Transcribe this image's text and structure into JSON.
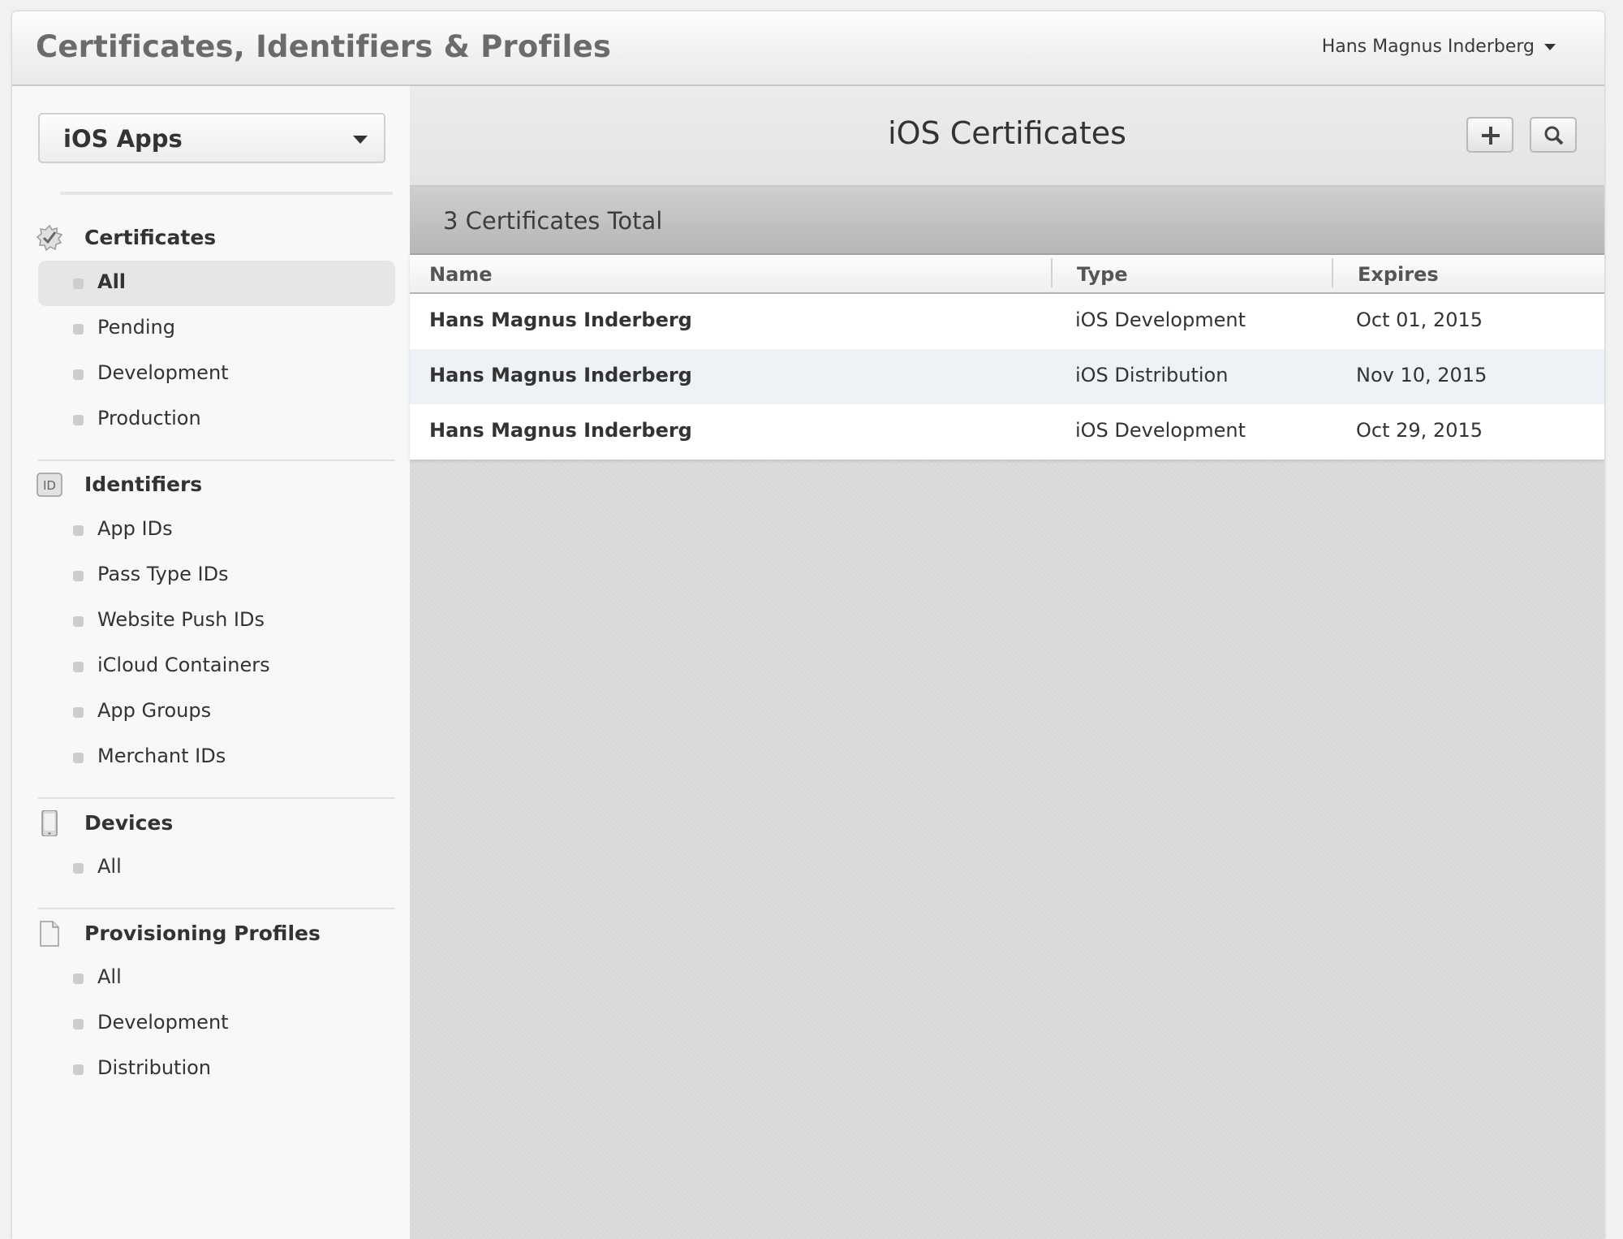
{
  "header": {
    "title": "Certificates, Identifiers & Profiles",
    "user_name": "Hans Magnus Inderberg"
  },
  "sidebar": {
    "platform": "iOS Apps",
    "sections": {
      "certificates": {
        "title": "Certificates",
        "icon": "certificate-badge-icon",
        "items": [
          "All",
          "Pending",
          "Development",
          "Production"
        ]
      },
      "identifiers": {
        "title": "Identifiers",
        "icon": "id-icon",
        "icon_text": "ID",
        "items": [
          "App IDs",
          "Pass Type IDs",
          "Website Push IDs",
          "iCloud Containers",
          "App Groups",
          "Merchant IDs"
        ]
      },
      "devices": {
        "title": "Devices",
        "icon": "device-icon",
        "items": [
          "All"
        ]
      },
      "profiles": {
        "title": "Provisioning Profiles",
        "icon": "document-icon",
        "items": [
          "All",
          "Development",
          "Distribution"
        ]
      }
    },
    "active_item": "certificates.All"
  },
  "main": {
    "title": "iOS Certificates",
    "add_icon": "plus-icon",
    "search_icon": "search-icon",
    "total_text": "3 Certificates Total",
    "columns": [
      "Name",
      "Type",
      "Expires"
    ],
    "rows": [
      {
        "name": "Hans Magnus Inderberg",
        "type": "iOS Development",
        "expires": "Oct 01, 2015"
      },
      {
        "name": "Hans Magnus Inderberg",
        "type": "iOS Distribution",
        "expires": "Nov 10, 2015"
      },
      {
        "name": "Hans Magnus Inderberg",
        "type": "iOS Development",
        "expires": "Oct 29, 2015"
      }
    ]
  },
  "colors": {
    "active_item_bg": "#e6e6e6",
    "alt_row_bg": "#eef2f6",
    "total_bar": "#c4c4c4"
  }
}
